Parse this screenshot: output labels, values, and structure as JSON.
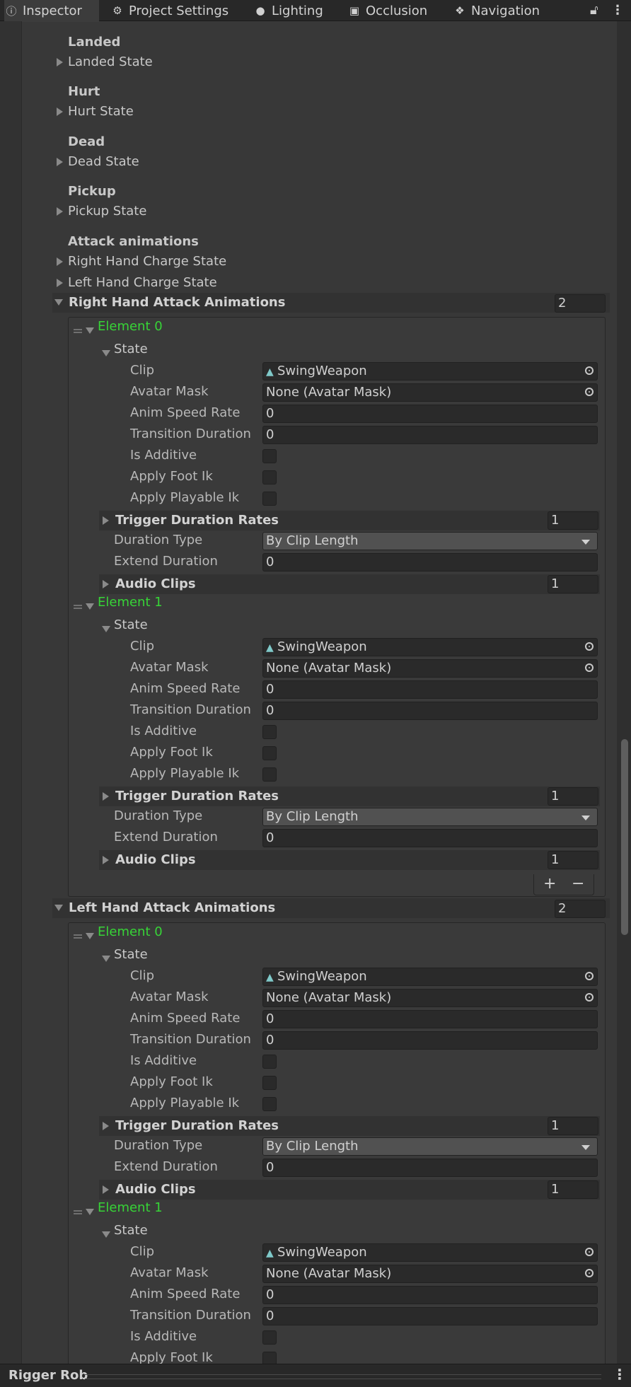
{
  "tabs": [
    {
      "label": "Inspector",
      "icon": "info-icon"
    },
    {
      "label": "Project Settings",
      "icon": "gear-icon"
    },
    {
      "label": "Lighting",
      "icon": "light-bulb-icon"
    },
    {
      "label": "Occlusion",
      "icon": "occlusion-icon"
    },
    {
      "label": "Navigation",
      "icon": "navigation-icon"
    }
  ],
  "sections": {
    "landed": {
      "header": "Landed",
      "state": "Landed State"
    },
    "hurt": {
      "header": "Hurt",
      "state": "Hurt State"
    },
    "dead": {
      "header": "Dead",
      "state": "Dead State"
    },
    "pickup": {
      "header": "Pickup",
      "state": "Pickup State"
    },
    "attack": {
      "header": "Attack animations",
      "right_charge": "Right Hand Charge State",
      "left_charge": "Left Hand Charge State"
    }
  },
  "labels": {
    "state": "State",
    "clip": "Clip",
    "avatar_mask": "Avatar Mask",
    "anim_speed_rate": "Anim Speed Rate",
    "transition_duration": "Transition Duration",
    "is_additive": "Is Additive",
    "apply_foot_ik": "Apply Foot Ik",
    "apply_playable_ik": "Apply Playable Ik",
    "trigger_duration_rates": "Trigger Duration Rates",
    "duration_type": "Duration Type",
    "extend_duration": "Extend Duration",
    "audio_clips": "Audio Clips"
  },
  "right_hand": {
    "title": "Right Hand Attack Animations",
    "count": "2",
    "elements": [
      {
        "name": "Element 0",
        "clip": "SwingWeapon",
        "avatar_mask": "None (Avatar Mask)",
        "anim_speed_rate": "0",
        "transition_duration": "0",
        "is_additive": false,
        "apply_foot_ik": false,
        "apply_playable_ik": false,
        "trigger_duration_rates_count": "1",
        "duration_type": "By Clip Length",
        "extend_duration": "0",
        "audio_clips_count": "1"
      },
      {
        "name": "Element 1",
        "clip": "SwingWeapon",
        "avatar_mask": "None (Avatar Mask)",
        "anim_speed_rate": "0",
        "transition_duration": "0",
        "is_additive": false,
        "apply_foot_ik": false,
        "apply_playable_ik": false,
        "trigger_duration_rates_count": "1",
        "duration_type": "By Clip Length",
        "extend_duration": "0",
        "audio_clips_count": "1"
      }
    ],
    "add_symbol": "+",
    "remove_symbol": "−"
  },
  "left_hand": {
    "title": "Left Hand Attack Animations",
    "count": "2",
    "elements": [
      {
        "name": "Element 0",
        "clip": "SwingWeapon",
        "avatar_mask": "None (Avatar Mask)",
        "anim_speed_rate": "0",
        "transition_duration": "0",
        "is_additive": false,
        "apply_foot_ik": false,
        "apply_playable_ik": false,
        "trigger_duration_rates_count": "1",
        "duration_type": "By Clip Length",
        "extend_duration": "0",
        "audio_clips_count": "1"
      },
      {
        "name": "Element 1",
        "clip": "SwingWeapon",
        "avatar_mask": "None (Avatar Mask)",
        "anim_speed_rate": "0",
        "transition_duration": "0",
        "is_additive": false,
        "apply_foot_ik": false
      }
    ]
  },
  "footer": {
    "title": "Rigger Rob"
  }
}
